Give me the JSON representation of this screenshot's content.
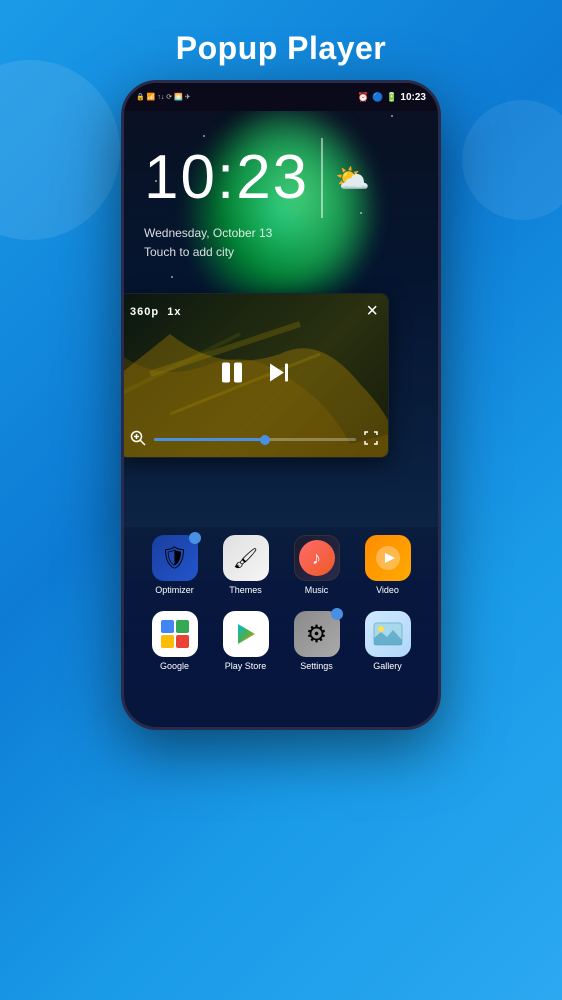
{
  "page": {
    "title": "Popup Player",
    "background_color": "#1a9be8"
  },
  "phone": {
    "status_bar": {
      "left_icons": "📶 ⊕ ↑ ◎ 🔵",
      "time": "10:23",
      "right_icons": "⏰ 🔵 🔋"
    },
    "lock_screen": {
      "time": "10:23",
      "date": "Wednesday, October 13",
      "weather_hint": "Touch to add city"
    },
    "popup_player": {
      "quality": "360p",
      "speed": "1x",
      "close_label": "×",
      "progress_percent": 55
    },
    "app_rows": [
      {
        "apps": [
          {
            "name": "Optimizer",
            "icon_type": "optimizer",
            "badge": true
          },
          {
            "name": "Themes",
            "icon_type": "themes",
            "badge": false
          },
          {
            "name": "Music",
            "icon_type": "music",
            "badge": false
          },
          {
            "name": "Video",
            "icon_type": "video",
            "badge": false
          }
        ]
      },
      {
        "apps": [
          {
            "name": "Google",
            "icon_type": "google",
            "badge": false
          },
          {
            "name": "Play Store",
            "icon_type": "playstore",
            "badge": false
          },
          {
            "name": "Settings",
            "icon_type": "settings",
            "badge": true
          },
          {
            "name": "Gallery",
            "icon_type": "gallery",
            "badge": false
          }
        ]
      }
    ]
  }
}
